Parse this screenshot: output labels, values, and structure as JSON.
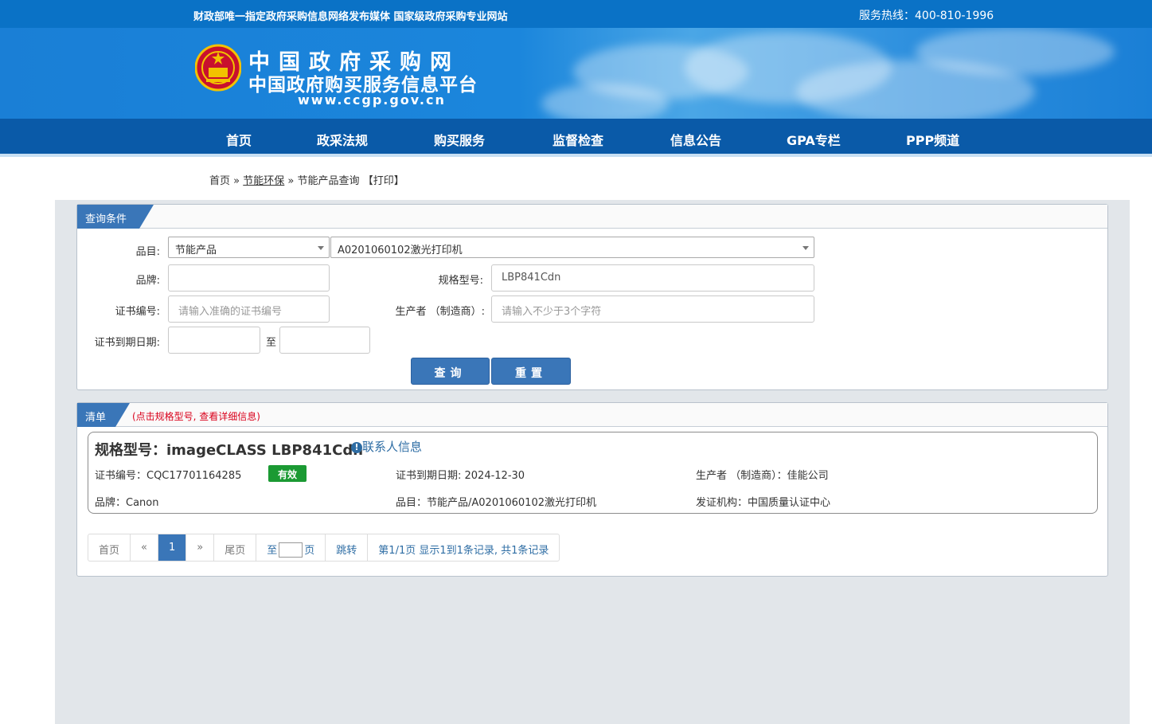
{
  "topbar": {
    "slogan": "财政部唯一指定政府采购信息网络发布媒体 国家级政府采购专业网站",
    "hotline": "服务热线：400-810-1996"
  },
  "logo": {
    "line1": "中国政府采购网",
    "line2": "中国政府购买服务信息平台",
    "url": "www.ccgp.gov.cn"
  },
  "nav": [
    "首页",
    "政采法规",
    "购买服务",
    "监督检查",
    "信息公告",
    "GPA专栏",
    "PPP频道"
  ],
  "breadcrumb": {
    "home": "首页",
    "sep": "»",
    "section": "节能环保",
    "current": "节能产品查询",
    "print": "【打印】"
  },
  "query": {
    "tab": "查询条件",
    "category_label": "品目:",
    "category_value": "节能产品",
    "subcategory_value": "A0201060102激光打印机",
    "brand_label": "品牌:",
    "brand_value": "",
    "model_label": "规格型号:",
    "model_value": "LBP841Cdn",
    "cert_label": "证书编号:",
    "cert_placeholder": "请输入准确的证书编号",
    "maker_label": "生产者 （制造商）:",
    "maker_placeholder": "请输入不少于3个字符",
    "expiry_label": "证书到期日期:",
    "to_label": "至",
    "search_button": "查询",
    "reset_button": "重置"
  },
  "list": {
    "tab": "清单",
    "hint": "(点击规格型号, 查看详细信息)",
    "item": {
      "title": "规格型号：imageCLASS LBP841Cdn",
      "contact": "联系人信息",
      "cert_no": "证书编号：CQC17701164285",
      "status": "有效",
      "expiry": "证书到期日期: 2024-12-30",
      "maker": "生产者 （制造商）：佳能公司",
      "brand": "品牌：Canon",
      "category": "品目：节能产品/A0201060102激光打印机",
      "issuer": "发证机构：中国质量认证中心"
    },
    "pager": {
      "first": "首页",
      "prev": "«",
      "current": "1",
      "next": "»",
      "last": "尾页",
      "to": "至",
      "page": "页",
      "jump": "跳转",
      "summary": "第1/1页  显示1到1条记录, 共1条记录"
    }
  },
  "colors": {
    "topbar": "#0a72c6",
    "nav": "#0a5aa8",
    "accent": "#3a76b8",
    "valid": "#1b9a33",
    "hint": "#d9001b"
  }
}
